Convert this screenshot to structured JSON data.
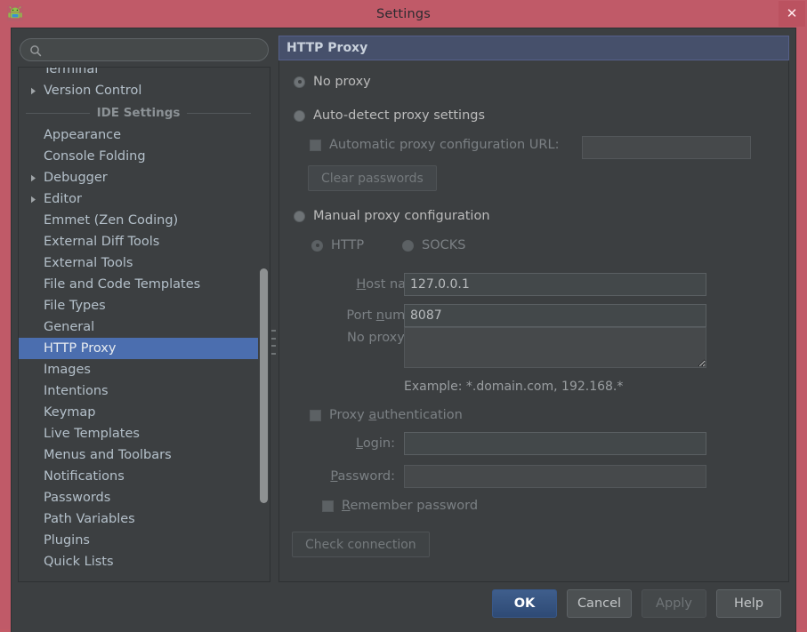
{
  "window": {
    "title": "Settings",
    "app_icon": "android-studio-icon",
    "close_label": "✕",
    "titlebar_color": "#c05a68"
  },
  "search": {
    "value": "",
    "placeholder": "",
    "icon": "search-icon"
  },
  "sidebar": {
    "items": [
      {
        "label": "Terminal",
        "expandable": false,
        "selected": false,
        "clipped": true
      },
      {
        "label": "Version Control",
        "expandable": true,
        "selected": false
      }
    ],
    "group_label": "IDE Settings",
    "ide_items": [
      {
        "label": "Appearance",
        "expandable": false,
        "selected": false
      },
      {
        "label": "Console Folding",
        "expandable": false,
        "selected": false
      },
      {
        "label": "Debugger",
        "expandable": true,
        "selected": false
      },
      {
        "label": "Editor",
        "expandable": true,
        "selected": false
      },
      {
        "label": "Emmet (Zen Coding)",
        "expandable": false,
        "selected": false
      },
      {
        "label": "External Diff Tools",
        "expandable": false,
        "selected": false
      },
      {
        "label": "External Tools",
        "expandable": false,
        "selected": false
      },
      {
        "label": "File and Code Templates",
        "expandable": false,
        "selected": false
      },
      {
        "label": "File Types",
        "expandable": false,
        "selected": false
      },
      {
        "label": "General",
        "expandable": false,
        "selected": false
      },
      {
        "label": "HTTP Proxy",
        "expandable": false,
        "selected": true
      },
      {
        "label": "Images",
        "expandable": false,
        "selected": false
      },
      {
        "label": "Intentions",
        "expandable": false,
        "selected": false
      },
      {
        "label": "Keymap",
        "expandable": false,
        "selected": false
      },
      {
        "label": "Live Templates",
        "expandable": false,
        "selected": false
      },
      {
        "label": "Menus and Toolbars",
        "expandable": false,
        "selected": false
      },
      {
        "label": "Notifications",
        "expandable": false,
        "selected": false
      },
      {
        "label": "Passwords",
        "expandable": false,
        "selected": false
      },
      {
        "label": "Path Variables",
        "expandable": false,
        "selected": false
      },
      {
        "label": "Plugins",
        "expandable": false,
        "selected": false
      },
      {
        "label": "Quick Lists",
        "expandable": false,
        "selected": false
      }
    ],
    "selection_color": "#4b6eaf"
  },
  "panel": {
    "header": "HTTP Proxy",
    "header_color": "#46506b",
    "no_proxy": {
      "label": "No proxy",
      "checked": true,
      "enabled": true
    },
    "auto_detect": {
      "label": "Auto-detect proxy settings",
      "checked": false,
      "enabled": true
    },
    "auto_config_url": {
      "label": "Automatic proxy configuration URL:",
      "checked": false,
      "enabled": false,
      "value": "",
      "placeholder": ""
    },
    "clear_passwords": {
      "label": "Clear passwords",
      "enabled": false
    },
    "manual": {
      "label": "Manual proxy configuration",
      "checked": false,
      "enabled": true
    },
    "protocol": {
      "http": {
        "label": "HTTP",
        "checked": true,
        "enabled": false
      },
      "socks": {
        "label": "SOCKS",
        "checked": false,
        "enabled": false
      }
    },
    "host_name": {
      "label": "Host name:",
      "mnemonic": "H",
      "value": "127.0.0.1",
      "enabled": false
    },
    "port_number": {
      "label": "Port number:",
      "mnemonic": "n",
      "value": "8087",
      "enabled": false
    },
    "no_proxy_for": {
      "label": "No proxy for:",
      "value": "",
      "enabled": false
    },
    "example_hint": "Example: *.domain.com, 192.168.*",
    "proxy_auth": {
      "label": "Proxy authentication",
      "mnemonic": "a",
      "checked": false,
      "enabled": false
    },
    "login": {
      "label": "Login:",
      "mnemonic": "L",
      "value": "",
      "enabled": false
    },
    "password": {
      "label": "Password:",
      "mnemonic": "P",
      "value": "",
      "enabled": false
    },
    "remember_password": {
      "label": "Remember password",
      "mnemonic": "R",
      "checked": false,
      "enabled": false
    },
    "check_connection": {
      "label": "Check connection",
      "enabled": false
    }
  },
  "buttons": {
    "ok": {
      "label": "OK",
      "default": true,
      "enabled": true
    },
    "cancel": {
      "label": "Cancel",
      "enabled": true
    },
    "apply": {
      "label": "Apply",
      "enabled": false
    },
    "help": {
      "label": "Help",
      "enabled": true
    }
  }
}
